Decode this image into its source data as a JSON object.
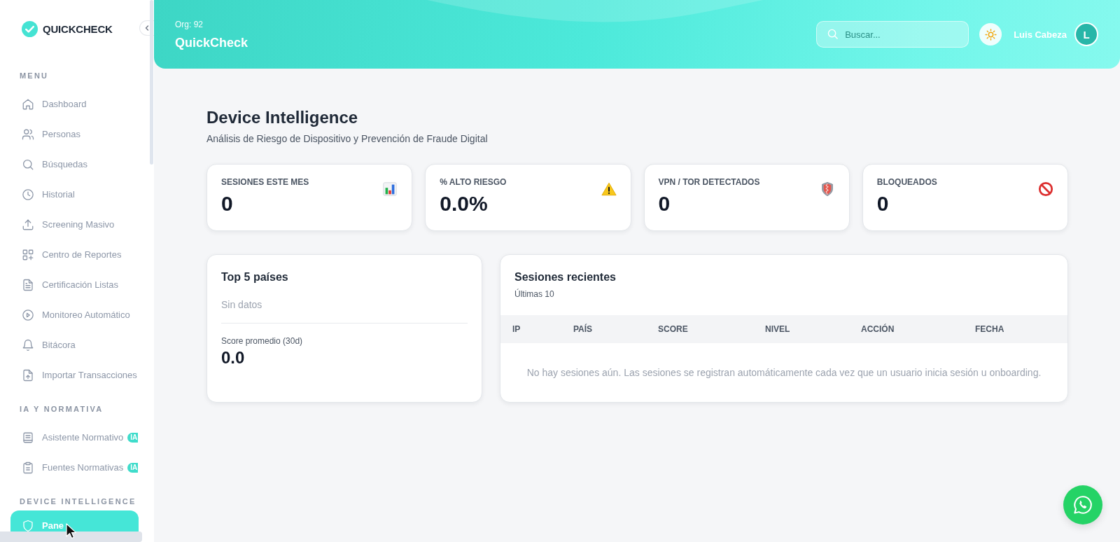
{
  "sidebar": {
    "logo": "QUICKCHECK",
    "sections": [
      {
        "title": "MENU",
        "items": [
          {
            "label": "Dashboard",
            "selected": false
          },
          {
            "label": "Personas",
            "selected": false
          },
          {
            "label": "Búsquedas",
            "selected": false
          },
          {
            "label": "Historial",
            "selected": false
          },
          {
            "label": "Screening Masivo",
            "selected": false
          },
          {
            "label": "Centro de Reportes",
            "selected": false
          },
          {
            "label": "Certificación Listas",
            "selected": false
          },
          {
            "label": "Monitoreo Automático",
            "selected": false
          },
          {
            "label": "Bitácora",
            "selected": false
          },
          {
            "label": "Importar Transacciones",
            "selected": false
          }
        ]
      },
      {
        "title": "IA Y NORMATIVA",
        "items": [
          {
            "label": "Asistente Normativo",
            "badge": "IA",
            "selected": false
          },
          {
            "label": "Fuentes Normativas",
            "badge": "IA",
            "selected": false
          }
        ]
      },
      {
        "title": "DEVICE INTELLIGENCE",
        "items": [
          {
            "label": "Pane",
            "selected": true
          }
        ]
      }
    ]
  },
  "header": {
    "org": "Org: 92",
    "title": "QuickCheck",
    "search": {
      "placeholder": "Buscar..."
    },
    "user": {
      "name": "Luis Cabeza",
      "initial": "L"
    }
  },
  "page": {
    "title": "Device Intelligence",
    "subtitle": "Análisis de Riesgo de Dispositivo y Prevención de Fraude Digital"
  },
  "stats": [
    {
      "label": "SESIONES ESTE MES",
      "value": "0"
    },
    {
      "label": "% ALTO RIESGO",
      "value": "0.0%"
    },
    {
      "label": "VPN / TOR DETECTADOS",
      "value": "0"
    },
    {
      "label": "BLOQUEADOS",
      "value": "0"
    }
  ],
  "top_countries": {
    "title": "Top 5 países",
    "empty_text": "Sin datos",
    "score_label": "Score promedio (30d)",
    "score_value": "0.0"
  },
  "recent_sessions": {
    "title": "Sesiones recientes",
    "subtitle": "Últimas 10",
    "columns": [
      "IP",
      "PAÍS",
      "SCORE",
      "NIVEL",
      "ACCIÓN",
      "FECHA"
    ],
    "empty_text": "No hay sesiones aún. Las sesiones se registran automáticamente cada vez que un usuario inicia sesión u onboarding."
  }
}
